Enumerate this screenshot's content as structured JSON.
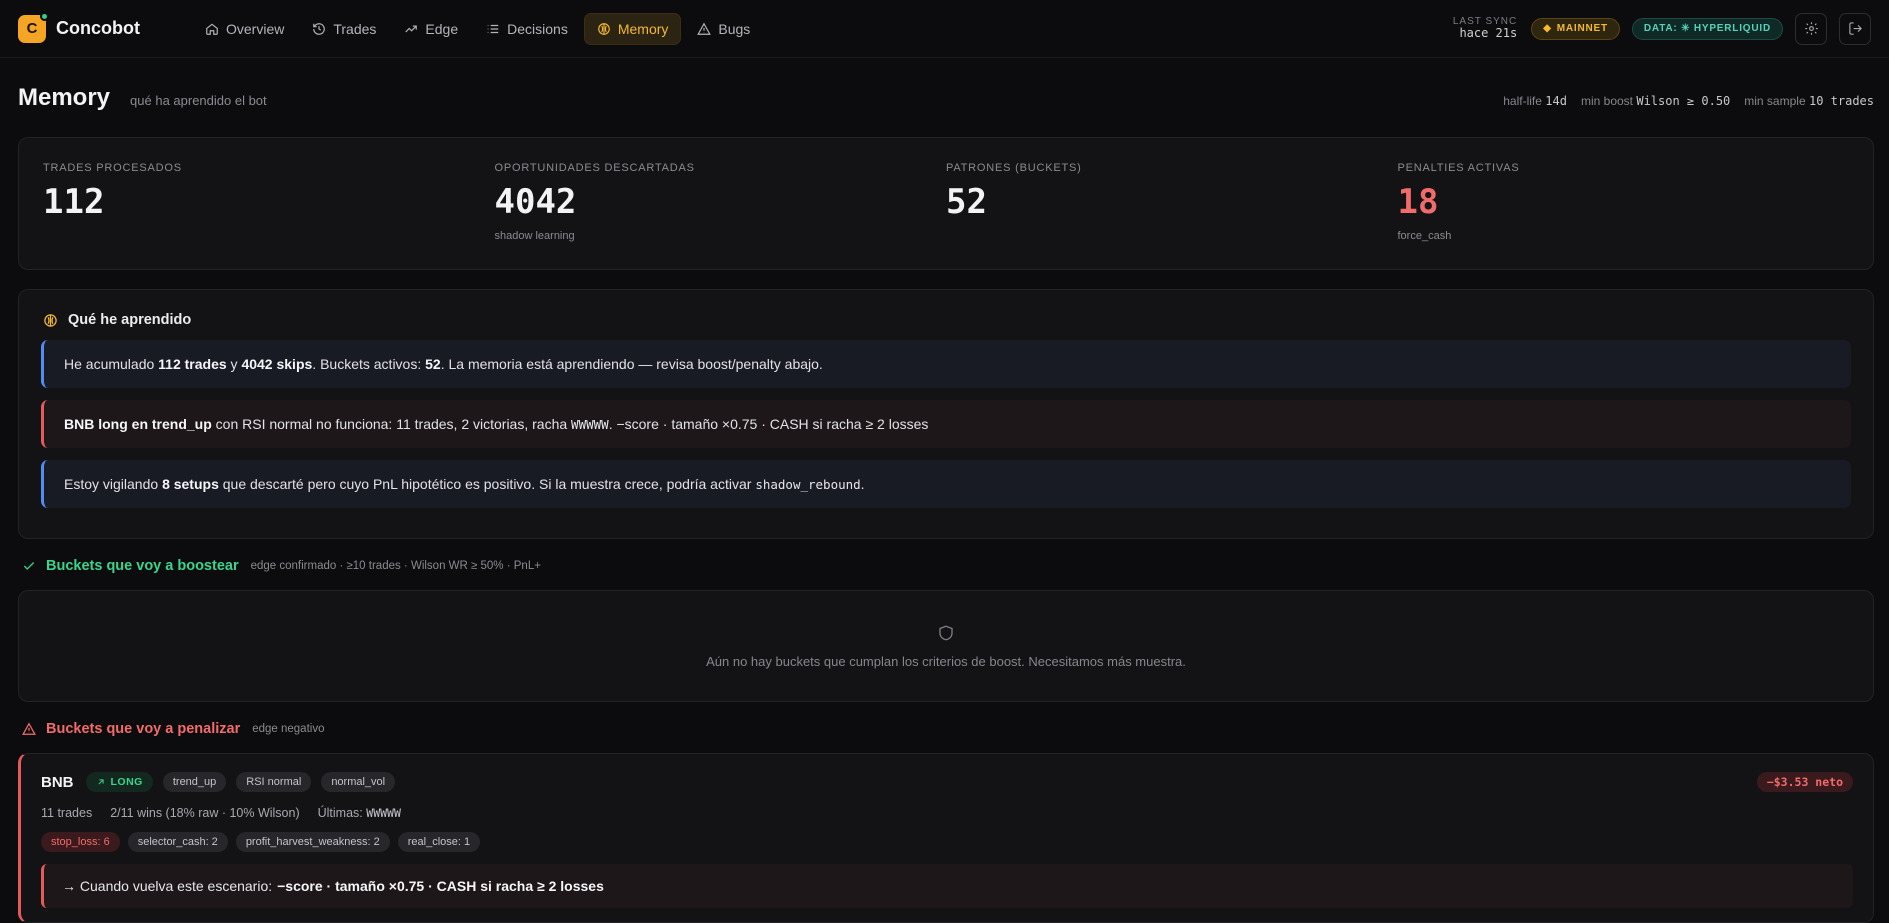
{
  "app": {
    "logo_letter": "C",
    "name": "Concobot"
  },
  "nav": [
    {
      "label": "Overview",
      "icon": "home-icon"
    },
    {
      "label": "Trades",
      "icon": "history-icon"
    },
    {
      "label": "Edge",
      "icon": "trend-icon"
    },
    {
      "label": "Decisions",
      "icon": "list-icon"
    },
    {
      "label": "Memory",
      "icon": "brain-icon",
      "active": true
    },
    {
      "label": "Bugs",
      "icon": "warning-icon"
    }
  ],
  "sync": {
    "label": "LAST SYNC",
    "value": "hace 21s"
  },
  "badges": {
    "network": "MAINNET",
    "data": "DATA: ✳ HYPERLIQUID"
  },
  "colors": {
    "accent": "#f5b82e",
    "positive": "#3ad48e",
    "negative": "#f26b6b",
    "info": "#4f8df5"
  },
  "page": {
    "title": "Memory",
    "subtitle": "qué ha aprendido el bot",
    "params": [
      {
        "key": "half-life",
        "value": "14d"
      },
      {
        "key": "min boost",
        "value": "Wilson ≥ 0.50"
      },
      {
        "key": "min sample",
        "value": "10 trades"
      }
    ]
  },
  "stats": [
    {
      "label": "TRADES PROCESADOS",
      "value": "112",
      "sub": ""
    },
    {
      "label": "OPORTUNIDADES DESCARTADAS",
      "value": "4042",
      "sub": "shadow learning"
    },
    {
      "label": "PATRONES (BUCKETS)",
      "value": "52",
      "sub": ""
    },
    {
      "label": "PENALTIES ACTIVAS",
      "value": "18",
      "sub": "force_cash"
    }
  ],
  "learned": {
    "title": "Qué he aprendido",
    "i1": {
      "a": "He acumulado ",
      "b": "112 trades",
      "c": " y ",
      "d": "4042 skips",
      "e": ". Buckets activos: ",
      "f": "52",
      "g": ". La memoria está aprendiendo — revisa boost/penalty abajo."
    },
    "i2": {
      "a": "BNB long en trend_up",
      "b": " con RSI normal no funciona: 11 trades, 2 victorias, racha ",
      "c": "WWWWW",
      "d": ". −score · tamaño ×0.75 · CASH si racha ≥ 2 losses"
    },
    "i3": {
      "a": "Estoy vigilando ",
      "b": "8 setups",
      "c": " que descarté pero cuyo PnL hipotético es positivo. Si la muestra crece, podría activar ",
      "d": "shadow_rebound",
      "e": "."
    }
  },
  "boost": {
    "title": "Buckets que voy a boostear",
    "subtitle": "edge confirmado · ≥10 trades · Wilson WR ≥ 50% · PnL+",
    "empty": "Aún no hay buckets que cumplan los criterios de boost. Necesitamos más muestra."
  },
  "penalize": {
    "title": "Buckets que voy a penalizar",
    "subtitle": "edge negativo",
    "bucket": {
      "symbol": "BNB",
      "direction": "LONG",
      "tags": [
        "trend_up",
        "RSI normal",
        "normal_vol"
      ],
      "net": "−$3.53 neto",
      "trades": "11 trades",
      "wins": "2/11 wins (18% raw · 10% Wilson)",
      "last_label": "Últimas:",
      "last_value": "WWWWW",
      "reasons": [
        "stop_loss: 6",
        "selector_cash: 2",
        "profit_harvest_weakness: 2",
        "real_close: 1"
      ],
      "action_label": "→ Cuando vuelva este escenario:",
      "action_value": "−score · tamaño ×0.75 · CASH si racha ≥ 2 losses"
    }
  }
}
